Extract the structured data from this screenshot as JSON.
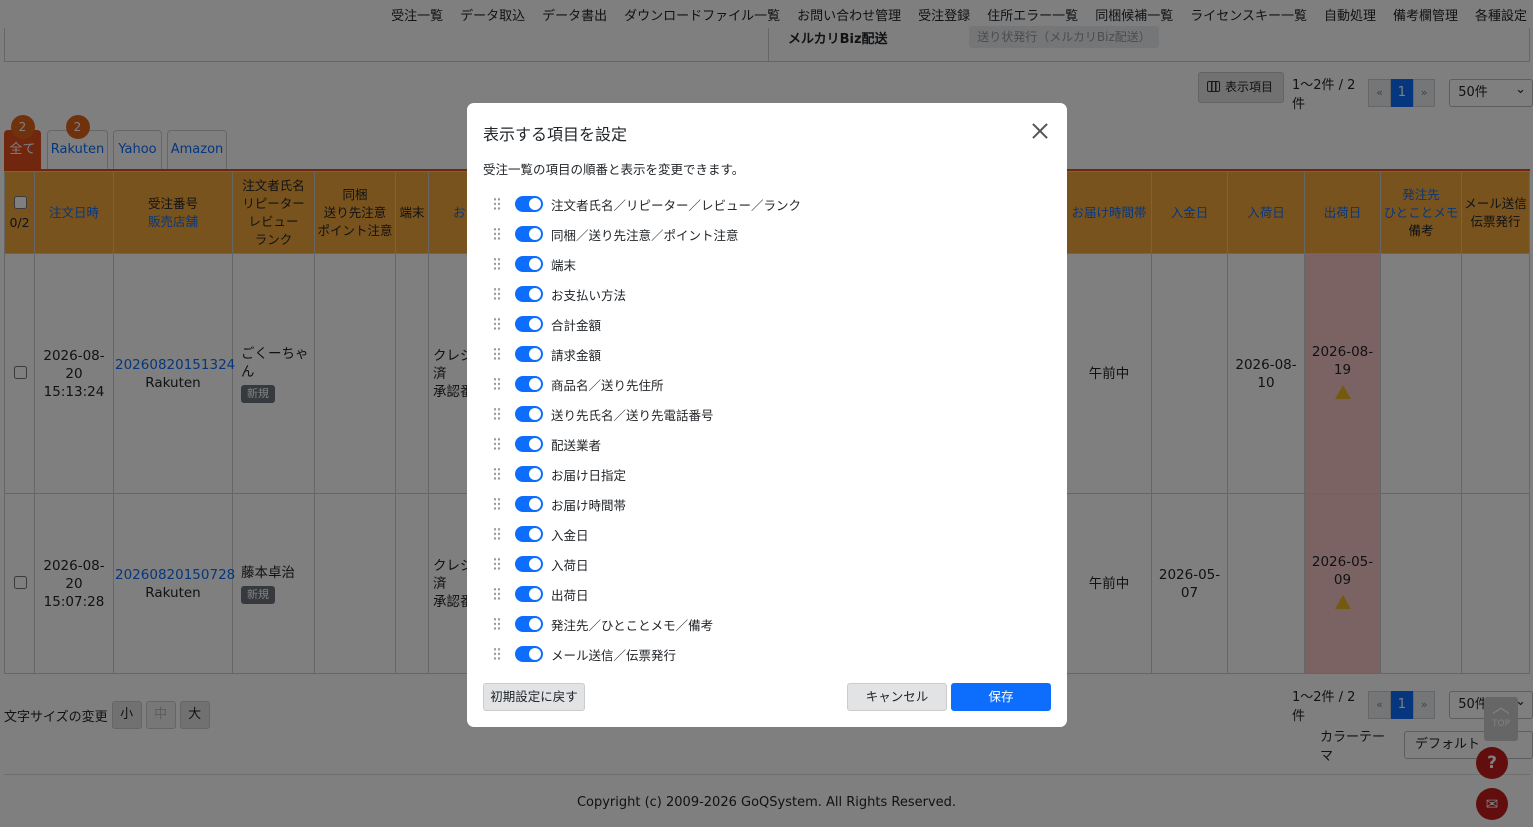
{
  "topnav": [
    "受注一覧",
    "データ取込",
    "データ書出",
    "ダウンロードファイル一覧",
    "お問い合わせ管理",
    "受注登録",
    "住所エラー一覧",
    "同梱候補一覧",
    "ライセンスキー一覧",
    "自動処理",
    "備考欄管理",
    "各種設定"
  ],
  "filter": {
    "mercari_label": "メルカリBiz配送",
    "mercari_button": "送り状発行（メルカリBiz配送）"
  },
  "toolbar": {
    "columns_button": "表示項目"
  },
  "pager": {
    "info": "1〜2件 / 2件",
    "prev": "«",
    "page": "1",
    "next": "»",
    "per_page": "50件"
  },
  "tabs": [
    {
      "label": "全て",
      "badge": "2"
    },
    {
      "label": "Rakuten",
      "badge": "2"
    },
    {
      "label": "Yahoo"
    },
    {
      "label": "Amazon"
    }
  ],
  "table": {
    "select_count": "0/2",
    "headers": {
      "order_date": "注文日時",
      "order_no_1": "受注番号",
      "order_no_2": "販売店舗",
      "customer": [
        "注文者氏名",
        "リピーター",
        "レビュー",
        "ランク"
      ],
      "bundle": [
        "同梱",
        "送り先注意",
        "ポイント注意"
      ],
      "terminal": "端末",
      "payment_partial": "お",
      "delivery_time": "お届け時間帯",
      "payment_date": "入金日",
      "arrival_date": "入荷日",
      "ship_date": "出荷日",
      "memo_1": "発注先",
      "memo_2": "ひとことメモ",
      "memo_3": "備考",
      "mail": [
        "メール送信",
        "伝票発行"
      ]
    },
    "rows": [
      {
        "date": [
          "2026-08-",
          "20",
          "15:13:24"
        ],
        "order_no": "20260820151324",
        "shop": "Rakuten",
        "customer": [
          "ごくーちゃ",
          "ん"
        ],
        "badge": "新規",
        "payment": [
          "クレジ",
          "済",
          "承認番"
        ],
        "time_slot": "午前中",
        "paid_date": "",
        "arrival": [
          "2026-08-",
          "10"
        ],
        "ship": [
          "2026-08-",
          "19"
        ]
      },
      {
        "date": [
          "2026-08-",
          "20",
          "15:07:28"
        ],
        "order_no": "20260820150728",
        "shop": "Rakuten",
        "customer": [
          "藤本卓治"
        ],
        "badge": "新規",
        "payment": [
          "クレジ",
          "済",
          "承認番"
        ],
        "time_slot": "午前中",
        "paid_date": [
          "2026-05-",
          "07"
        ],
        "arrival": "",
        "ship": [
          "2026-05-",
          "09"
        ]
      }
    ]
  },
  "font_size": {
    "label": "文字サイズの変更",
    "small": "小",
    "medium": "中",
    "large": "大"
  },
  "theme": {
    "label": "カラーテーマ",
    "value": "デフォルト"
  },
  "footer": {
    "copyright": "Copyright (c) 2009-2026 GoQSystem. All Rights Reserved.",
    "top": "TOP"
  },
  "modal": {
    "title": "表示する項目を設定",
    "description": "受注一覧の項目の順番と表示を変更できます。",
    "items": [
      "注文者氏名／リピーター／レビュー／ランク",
      "同梱／送り先注意／ポイント注意",
      "端末",
      "お支払い方法",
      "合計金額",
      "請求金額",
      "商品名／送り先住所",
      "送り先氏名／送り先電話番号",
      "配送業者",
      "お届け日指定",
      "お届け時間帯",
      "入金日",
      "入荷日",
      "出荷日",
      "発注先／ひとことメモ／備考",
      "メール送信／伝票発行"
    ],
    "reset_button": "初期設定に戻す",
    "cancel_button": "キャンセル",
    "save_button": "保存"
  },
  "colors": {
    "accent": "#0d6efd",
    "header": "#f3a73b",
    "tab_active": "#e04e1a",
    "ship_cell": "#f7c6c8"
  }
}
